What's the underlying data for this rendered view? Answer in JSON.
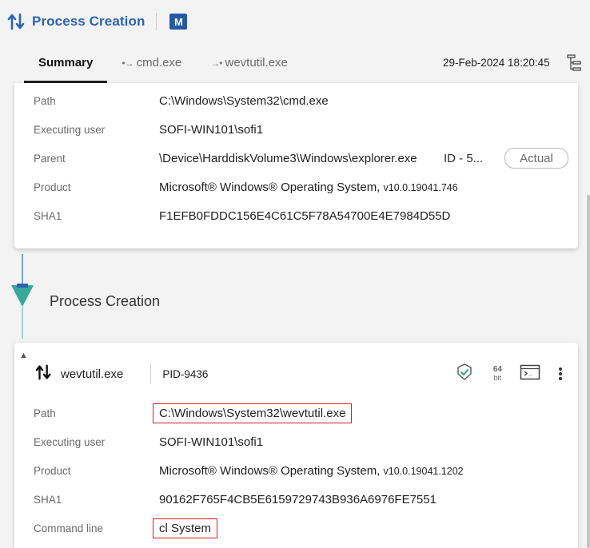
{
  "header": {
    "title": "Process Creation",
    "mitre_label": "M"
  },
  "tabs": [
    {
      "label": "Summary",
      "active": true
    },
    {
      "label": "cmd.exe",
      "arrow": "•→"
    },
    {
      "label": "wevtutil.exe",
      "arrow": "→•"
    }
  ],
  "timestamp": "29-Feb-2024 18:20:45",
  "card1": {
    "path_label": "Path",
    "path": "C:\\Windows\\System32\\cmd.exe",
    "user_label": "Executing user",
    "user": "SOFI-WIN101\\sofi1",
    "parent_label": "Parent",
    "parent": "\\Device\\HarddiskVolume3\\Windows\\explorer.exe",
    "parent_id": "ID - 5...",
    "actual_label": "Actual",
    "product_label": "Product",
    "product": "Microsoft® Windows® Operating System,",
    "product_version": "v10.0.19041.746",
    "sha1_label": "SHA1",
    "sha1": "F1EFB0FDDC156E4C61C5F78A54700E4E7984D55D"
  },
  "connector": {
    "title": "Process Creation"
  },
  "card2": {
    "process_name": "wevtutil.exe",
    "pid": "PID-9436",
    "bitness_value": "64",
    "bitness_unit": "bit",
    "path_label": "Path",
    "path": "C:\\Windows\\System32\\wevtutil.exe",
    "user_label": "Executing user",
    "user": "SOFI-WIN101\\sofi1",
    "product_label": "Product",
    "product": "Microsoft® Windows® Operating System,",
    "product_version": "v10.0.19041.1202",
    "sha1_label": "SHA1",
    "sha1": "90162F765F4CB5E6159729743B936A6976FE7551",
    "cmd_label": "Command line",
    "cmd": "cl System"
  },
  "colors": {
    "accent": "#2a63b8",
    "mitre": "#2459a8",
    "connector_teal": "#3aa899",
    "highlight": "#d42020"
  }
}
